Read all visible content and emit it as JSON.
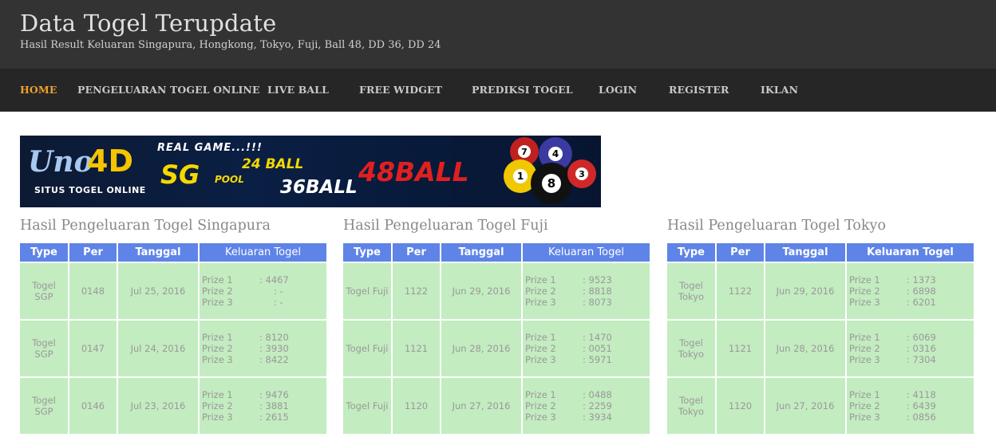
{
  "header": {
    "title": "Data Togel Terupdate",
    "tagline": "Hasil Result Keluaran Singapura, Hongkong, Tokyo, Fuji, Ball 48, DD 36, DD 24"
  },
  "nav": {
    "items": [
      "HOME",
      "PENGELUARAN TOGEL ONLINE",
      "LIVE BALL",
      "FREE WIDGET",
      "PREDIKSI TOGEL",
      "LOGIN",
      "REGISTER",
      "IKLAN"
    ]
  },
  "banner": {
    "brand_left": "Uno",
    "brand_right": "4D",
    "brand_sub": "SITUS TOGEL ONLINE",
    "real_game": "REAL GAME...!!!",
    "sg": "SG",
    "pool": "POOL",
    "ball24": "24 BALL",
    "ball36": "36BALL",
    "ball48": "48BALL",
    "balls": [
      "7",
      "4",
      "1",
      "8",
      "3"
    ]
  },
  "columns": [
    "Type",
    "Per",
    "Tanggal",
    "Keluaran Togel"
  ],
  "prize_labels": [
    "Prize 1",
    "Prize 2",
    "Prize 3"
  ],
  "tables": [
    {
      "title": "Hasil Pengeluaran Togel Singapura",
      "rows": [
        {
          "type": "Togel SGP",
          "per": "0148",
          "date": "Jul 25, 2016",
          "prizes": [
            ": 4467",
            ": -",
            ": -"
          ]
        },
        {
          "type": "Togel SGP",
          "per": "0147",
          "date": "Jul 24, 2016",
          "prizes": [
            ": 8120",
            ": 3930",
            ": 8422"
          ]
        },
        {
          "type": "Togel SGP",
          "per": "0146",
          "date": "Jul 23, 2016",
          "prizes": [
            ": 9476",
            ": 3881",
            ": 2615"
          ]
        }
      ]
    },
    {
      "title": "Hasil Pengeluaran Togel Fuji",
      "rows": [
        {
          "type": "Togel Fuji",
          "per": "1122",
          "date": "Jun 29, 2016",
          "prizes": [
            ": 9523",
            ": 8818",
            ": 8073"
          ]
        },
        {
          "type": "Togel Fuji",
          "per": "1121",
          "date": "Jun 28, 2016",
          "prizes": [
            ": 1470",
            ": 0051",
            ": 5971"
          ]
        },
        {
          "type": "Togel Fuji",
          "per": "1120",
          "date": "Jun 27, 2016",
          "prizes": [
            ": 0488",
            ": 2259",
            ": 3934"
          ]
        }
      ]
    },
    {
      "title": "Hasil Pengeluaran Togel Tokyo",
      "rows": [
        {
          "type": "Togel Tokyo",
          "per": "1122",
          "date": "Jun 29, 2016",
          "prizes": [
            ": 1373",
            ": 6898",
            ": 6201"
          ]
        },
        {
          "type": "Togel Tokyo",
          "per": "1121",
          "date": "Jun 28, 2016",
          "prizes": [
            ": 6069",
            ": 0316",
            ": 7304"
          ]
        },
        {
          "type": "Togel Tokyo",
          "per": "1120",
          "date": "Jun 27, 2016",
          "prizes": [
            ": 4118",
            ": 6439",
            ": 0856"
          ]
        }
      ]
    }
  ],
  "colors": {
    "header_bg": "#333333",
    "nav_bg": "#262626",
    "nav_active": "#f0a030",
    "table_header_bg": "#5f84e8",
    "table_cell_bg": "#c3ecc0"
  }
}
